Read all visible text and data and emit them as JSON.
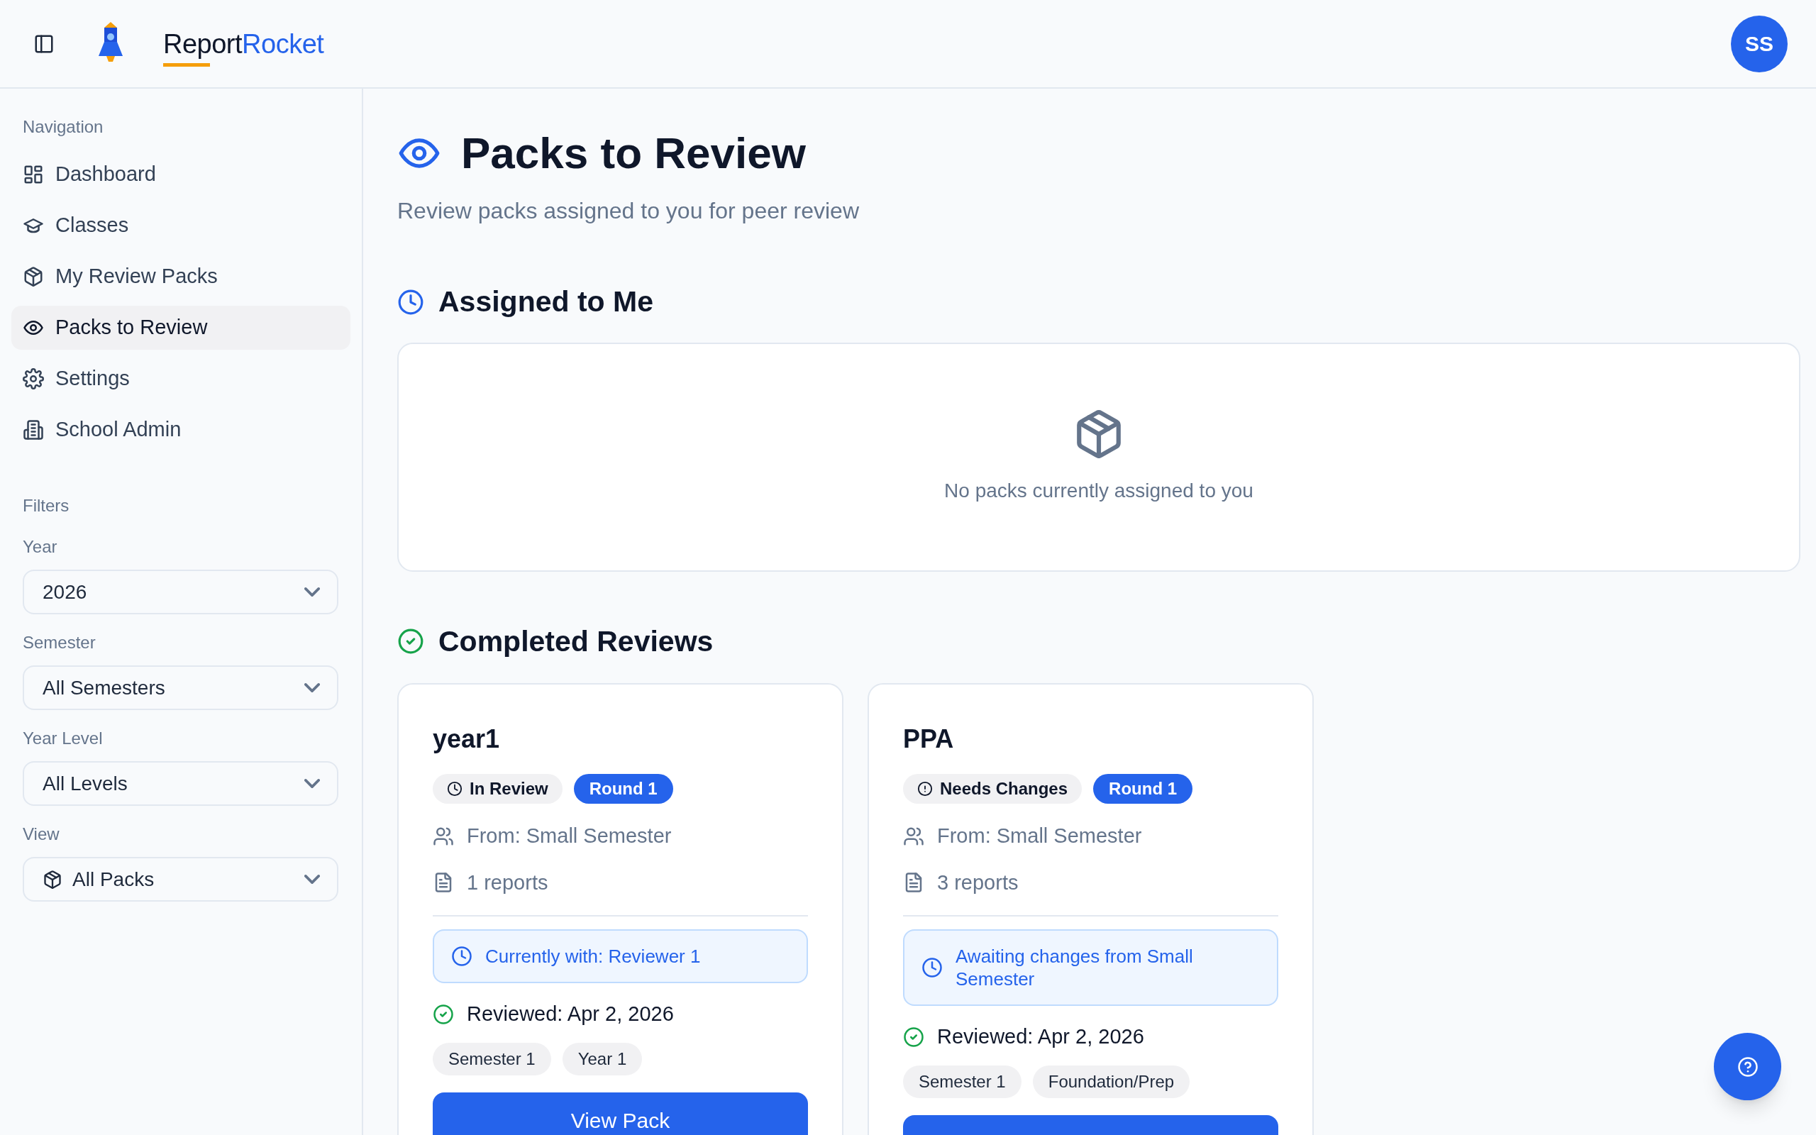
{
  "header": {
    "logo": {
      "part_1": "Report",
      "part_2": "Rocket"
    },
    "avatar": "SS"
  },
  "sidebar": {
    "nav_heading": "Navigation",
    "items": [
      {
        "label": "Dashboard",
        "selected": false
      },
      {
        "label": "Classes",
        "selected": false
      },
      {
        "label": "My Review Packs",
        "selected": false
      },
      {
        "label": "Packs to Review",
        "selected": true
      },
      {
        "label": "Settings",
        "selected": false
      },
      {
        "label": "School Admin",
        "selected": false
      }
    ],
    "filters_heading": "Filters",
    "filters": [
      {
        "label": "Year",
        "value": "2026",
        "kind": "plain"
      },
      {
        "label": "Semester",
        "value": "All Semesters",
        "kind": "plain"
      },
      {
        "label": "Year Level",
        "value": "All Levels",
        "kind": "plain"
      },
      {
        "label": "View",
        "value": "All Packs",
        "kind": "with_icon"
      }
    ]
  },
  "main": {
    "title": "Packs to Review",
    "subtitle": "Review packs assigned to you for peer review",
    "assigned": {
      "heading": "Assigned to Me",
      "empty_text": "No packs currently assigned to you"
    },
    "completed": {
      "heading": "Completed Reviews",
      "cards": [
        {
          "title": "year1",
          "status": {
            "label": "In Review",
            "kind": "in_review"
          },
          "round": "Round 1",
          "from": "From: Small Semester",
          "reports": "1 reports",
          "note": "Currently with: Reviewer 1",
          "reviewed": "Reviewed: Apr 2, 2026",
          "tags": [
            "Semester 1",
            "Year 1"
          ],
          "button": "View Pack"
        },
        {
          "title": "PPA",
          "status": {
            "label": "Needs Changes",
            "kind": "needs_changes"
          },
          "round": "Round 1",
          "from": "From: Small Semester",
          "reports": "3 reports",
          "note": "Awaiting changes from Small Semester",
          "reviewed": "Reviewed: Apr 2, 2026",
          "tags": [
            "Semester 1",
            "Foundation/Prep"
          ]
        }
      ]
    }
  }
}
